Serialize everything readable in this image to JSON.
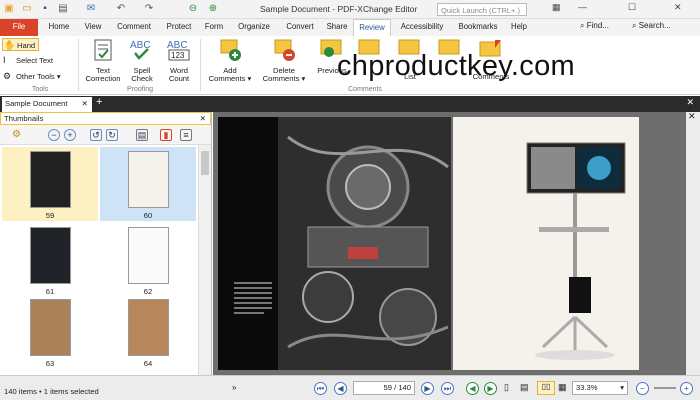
{
  "titlebar": {
    "title": "Sample Document - PDF-XChange Editor",
    "quick_launch_placeholder": "Quick Launch (CTRL+.)",
    "find_label": "Find...",
    "search_label": "Search..."
  },
  "menu": {
    "tabs": [
      "File",
      "Home",
      "View",
      "Comment",
      "Protect",
      "Form",
      "Organize",
      "Convert",
      "Share",
      "Review",
      "Accessibility",
      "Bookmarks",
      "Help"
    ],
    "active": "Review"
  },
  "ribbon": {
    "tools": {
      "hand": "Hand",
      "select_text": "Select Text",
      "other_tools": "Other Tools",
      "group": "Tools"
    },
    "proofing": {
      "text_correction": "Text Correction",
      "spell_check": "Spell Check",
      "word_count": "Word Count",
      "group": "Proofing"
    },
    "comments": {
      "add": "Add Comments",
      "delete": "Delete Comments",
      "previous": "Previous",
      "next": "Next",
      "list": "List",
      "summarize": "Comments",
      "group": "Comments"
    }
  },
  "watermark": "chproductkey.com",
  "document_tab": "Sample Document",
  "thumbnails": {
    "title": "Thumbnails",
    "pages": [
      "59",
      "60",
      "61",
      "62",
      "63",
      "64"
    ],
    "selected": "60"
  },
  "status": {
    "items_text": "140 items • 1 items selected",
    "page_value": "59",
    "page_total": "/ 140",
    "zoom": "33.3%"
  },
  "colors": {
    "file_tab": "#d9432a",
    "accent": "#2b5797",
    "selection": "#cfe3f7",
    "current": "#fdf1c4"
  }
}
